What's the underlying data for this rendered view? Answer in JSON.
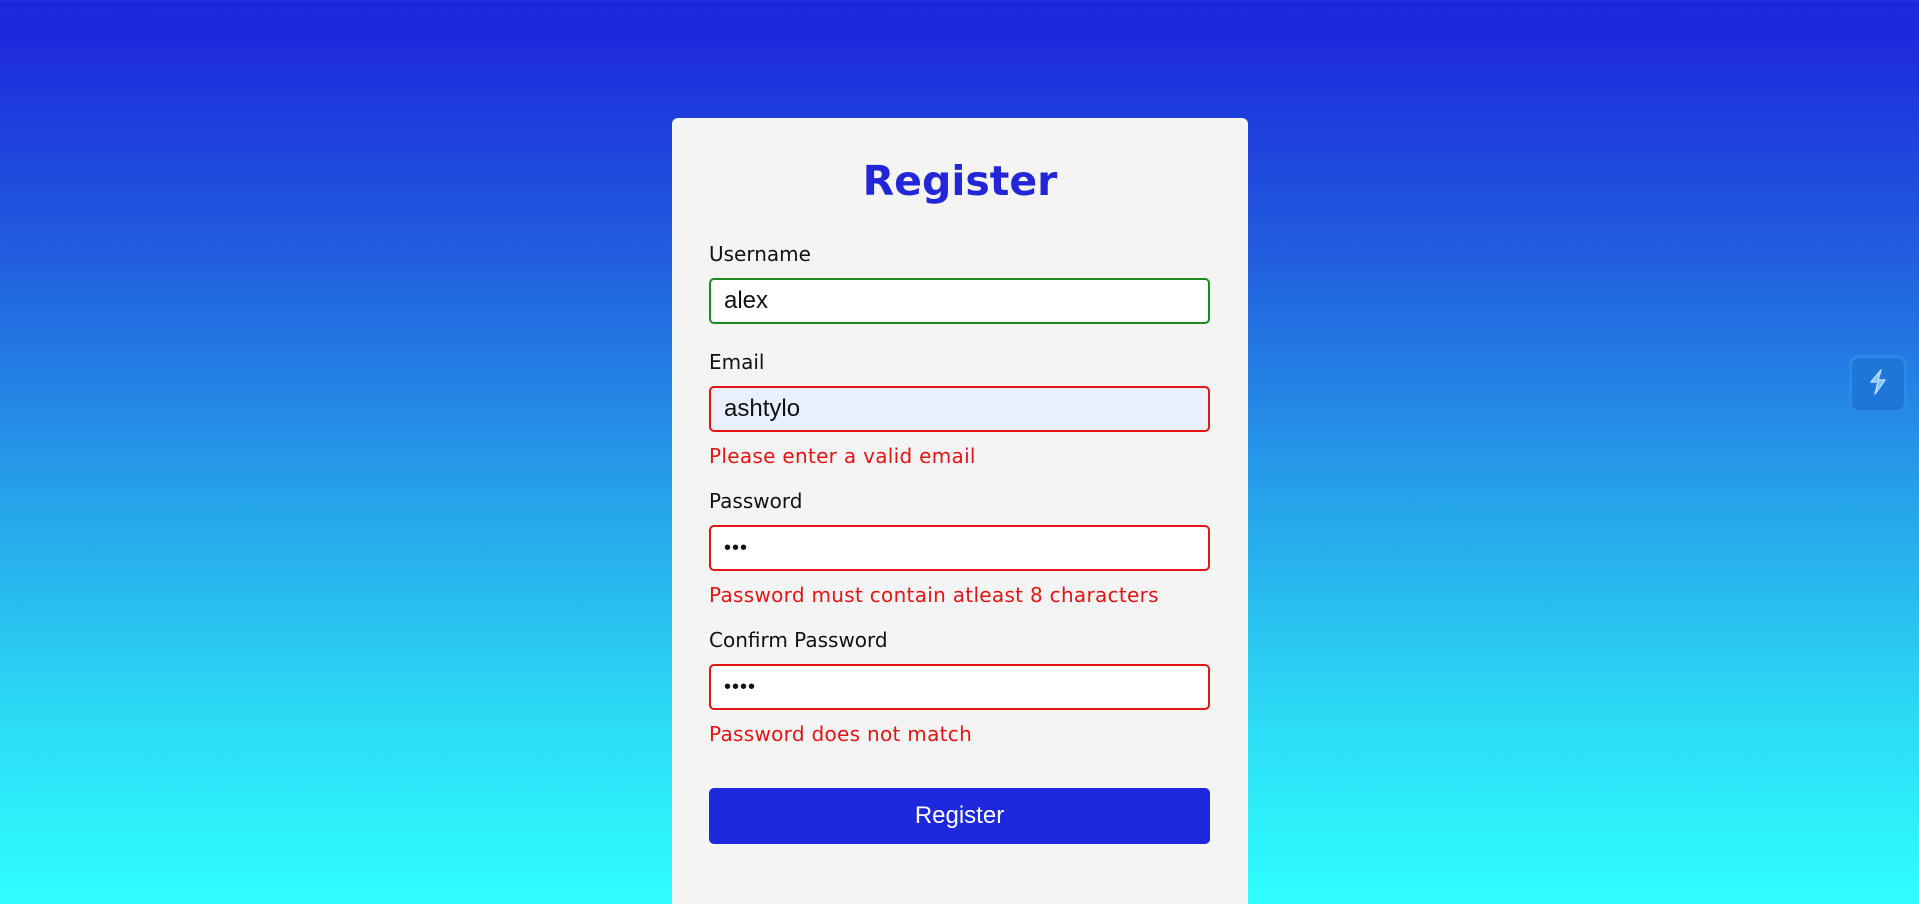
{
  "form": {
    "title": "Register",
    "username": {
      "label": "Username",
      "value": "alex",
      "state": "valid"
    },
    "email": {
      "label": "Email",
      "value": "ashtylo",
      "error": "Please enter a valid email",
      "state": "invalid"
    },
    "password": {
      "label": "Password",
      "value": "abc",
      "error": "Password must contain atleast 8 characters",
      "state": "invalid"
    },
    "confirm_password": {
      "label": "Confirm Password",
      "value": "abcd",
      "error": "Password does not match",
      "state": "invalid"
    },
    "submit_label": "Register"
  },
  "colors": {
    "primary": "#1d28dc",
    "title": "#2226d6",
    "error": "#e31414",
    "valid": "#1f8a1f",
    "card_bg": "#f4f4f4",
    "gradient_top": "#1d28dc",
    "gradient_bottom": "#2effff"
  },
  "extension_widget": {
    "icon": "lightning-bolt-icon"
  }
}
